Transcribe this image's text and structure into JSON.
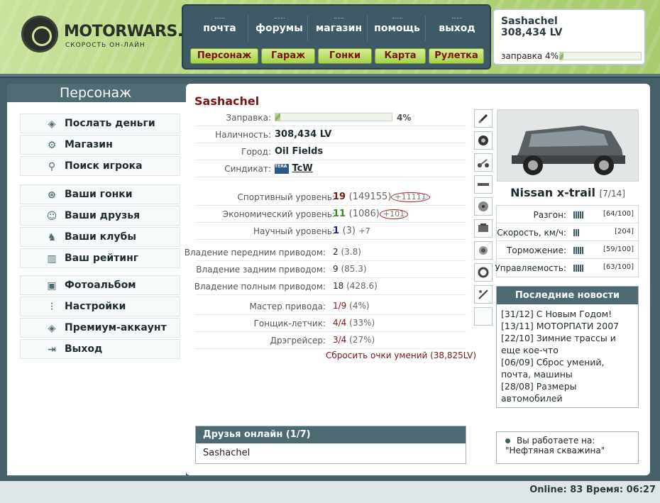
{
  "brand": {
    "name": "MOTORWARS.RU",
    "tagline": "СКОРОСТЬ ОН-ЛАЙН"
  },
  "nav_top": [
    "почта",
    "форумы",
    "магазин",
    "помощь",
    "выход"
  ],
  "nav_buttons": [
    "Персонаж",
    "Гараж",
    "Гонки",
    "Карта",
    "Рулетка"
  ],
  "user": {
    "name": "Sashachel",
    "balance": "308,434 LV",
    "fuel_label": "заправка 4%",
    "fuel_percent": 4
  },
  "left": {
    "title": "Персонаж",
    "group1": [
      "Послать деньги",
      "Магазин",
      "Поиск игрока"
    ],
    "group2": [
      "Ваши гонки",
      "Ваши друзья",
      "Ваши клубы",
      "Ваш рейтинг"
    ],
    "group3": [
      "Фотоальбом",
      "Настройки",
      "Премиум-аккаунт",
      "Выход"
    ]
  },
  "profile": {
    "name": "Sashachel",
    "fuel_label": "Заправка:",
    "fuel_value": "4%",
    "fuel_percent": 4,
    "cash_label": "Наличность:",
    "cash_value": "308,434 LV",
    "city_label": "Город:",
    "city_value": "Oil Fields",
    "syndicate_label": "Синдикат:",
    "syndicate_badge": "TERA WIN",
    "syndicate_value": "TcW"
  },
  "levels": [
    {
      "label": "Спортивный уровень:",
      "level": "19",
      "points": "(149155)",
      "bonus": "+11111",
      "color": "#7a1515",
      "circled": true
    },
    {
      "label": "Экономический уровень:",
      "level": "11",
      "points": "(1086)",
      "bonus": "+101",
      "color": "#3a8a1a",
      "circled": true
    },
    {
      "label": "Научный уровень:",
      "level": "1",
      "points": "(3)",
      "bonus": "+7",
      "color": "#1a2a80",
      "circled": false
    }
  ],
  "drive": [
    {
      "label": "Владение передним приводом:",
      "value": "2",
      "sub": "(3.8)"
    },
    {
      "label": "Владение задним приводом:",
      "value": "9",
      "sub": "(85.3)"
    },
    {
      "label": "Владение полным приводом:",
      "value": "18",
      "sub": "(428.6)"
    }
  ],
  "masteries": [
    {
      "label": "Мастер привода:",
      "value": "1/9",
      "sub": "(4%)"
    },
    {
      "label": "Гонщик-летчик:",
      "value": "4/4",
      "sub": "(33%)"
    },
    {
      "label": "Дрэгрейсер:",
      "value": "3/4",
      "sub": "(27%)"
    }
  ],
  "reset_link": "Сбросить очки умений (38,825LV)",
  "car": {
    "name": "Nissan x-trail",
    "count": "[7/14]"
  },
  "car_stats": [
    {
      "label": "Разгон:",
      "value": "[64/100]",
      "level": 64
    },
    {
      "label": "Скорость, км/ч:",
      "value": "[204]",
      "level": 50
    },
    {
      "label": "Торможение:",
      "value": "[59/100]",
      "level": 59
    },
    {
      "label": "Управляемость:",
      "value": "[63/100]",
      "level": 63
    }
  ],
  "news": {
    "title": "Последние новости",
    "items": [
      "[31/12] С Новым Годом!",
      "[13/11] МОТОРПАТИ 2007",
      "[22/10] Зимние трассы и еще кое-что",
      "[06/09] Сброс умений, почта, машины",
      "[28/08] Размеры автомобилей"
    ]
  },
  "friends": {
    "title": "Друзья онлайн (1/7)",
    "list": [
      "Sashachel"
    ]
  },
  "work": {
    "label": "Вы работаете на:",
    "place": "\"Нефтяная скважина\""
  },
  "footer": {
    "online": "Online: 83  Время: 06:27"
  }
}
